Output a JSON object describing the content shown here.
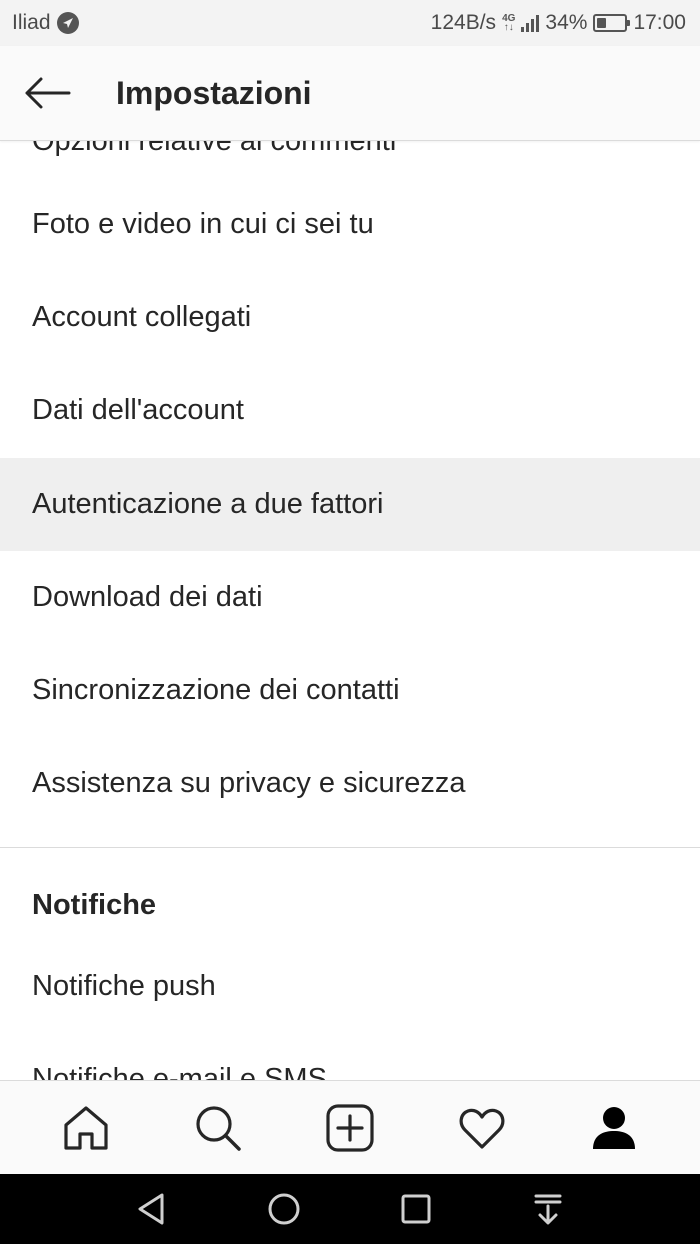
{
  "status_bar": {
    "carrier": "Iliad",
    "net_speed": "124B/s",
    "network_type_top": "4G",
    "network_type_bottom": "↑↓",
    "battery_percent": "34%",
    "battery_level": 0.34,
    "time": "17:00",
    "icons": [
      "location-arrow-icon",
      "signal-icon",
      "battery-icon"
    ]
  },
  "header": {
    "title": "Impostazioni",
    "back_icon": "arrow-left-icon"
  },
  "settings": {
    "partial_item": "Opzioni relative ai commenti",
    "items": [
      "Foto e video in cui ci sei tu",
      "Account collegati",
      "Dati dell'account",
      "Autenticazione a due fattori",
      "Download dei dati",
      "Sincronizzazione dei contatti",
      "Assistenza su privacy e sicurezza"
    ],
    "highlighted_item": "Autenticazione a due fattori"
  },
  "notifications": {
    "heading": "Notifiche",
    "items": [
      "Notifiche push",
      "Notifiche e-mail e SMS"
    ]
  },
  "tab_bar": {
    "tabs": [
      "home-icon",
      "search-icon",
      "new-post-icon",
      "activity-heart-icon",
      "profile-icon"
    ],
    "active_tab": "profile-icon"
  },
  "android_nav": {
    "buttons": [
      "back-triangle-icon",
      "home-circle-icon",
      "recents-square-icon",
      "notifications-pull-icon"
    ]
  },
  "colors": {
    "text": "#262626",
    "highlight_bg": "#efefef",
    "header_bg": "#fafafa",
    "status_bar_bg": "#f3f3f3",
    "divider": "#dbdbdb",
    "android_nav_bg": "#000000"
  }
}
